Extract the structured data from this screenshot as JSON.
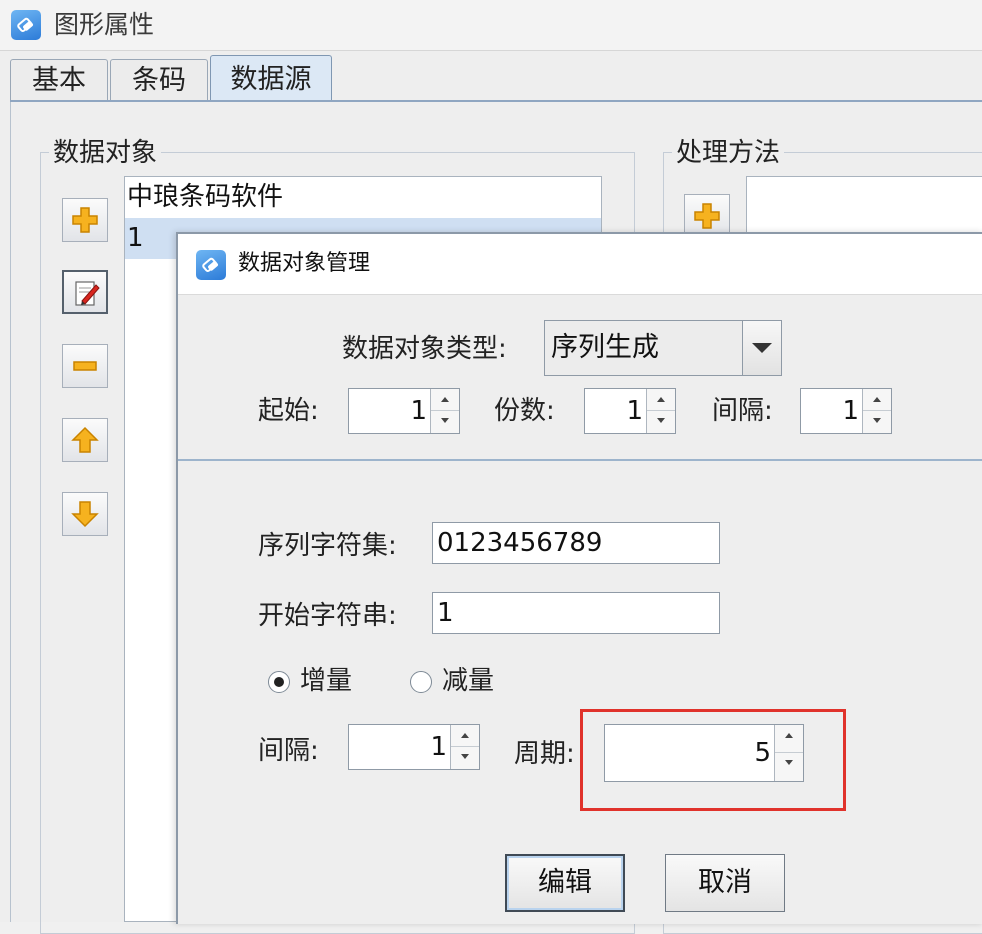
{
  "window": {
    "title": "图形属性"
  },
  "tabs": [
    {
      "label": "基本"
    },
    {
      "label": "条码"
    },
    {
      "label": "数据源"
    }
  ],
  "data_objects": {
    "title": "数据对象",
    "items": [
      {
        "label": "中琅条码软件"
      },
      {
        "label": "1"
      }
    ],
    "toolbar": [
      "add-icon",
      "edit-icon",
      "remove-icon",
      "move-up-icon",
      "move-down-icon"
    ]
  },
  "processing": {
    "title": "处理方法"
  },
  "dialog": {
    "title": "数据对象管理",
    "type_label": "数据对象类型:",
    "type_value": "序列生成",
    "start_label": "起始:",
    "start_value": "1",
    "copies_label": "份数:",
    "copies_value": "1",
    "interval_label": "间隔:",
    "interval_value": "1",
    "charset_label": "序列字符集:",
    "charset_value": "0123456789",
    "start_string_label": "开始字符串:",
    "start_string_value": "1",
    "increment_label": "增量",
    "decrement_label": "减量",
    "increment_selected": true,
    "step_interval_label": "间隔:",
    "step_interval_value": "1",
    "period_label": "周期:",
    "period_value": "5",
    "edit_button": "编辑",
    "cancel_button": "取消"
  },
  "colors": {
    "highlight": "#e0322b",
    "selection": "#cfdff2",
    "accent_blue": "#2c7bd8"
  }
}
